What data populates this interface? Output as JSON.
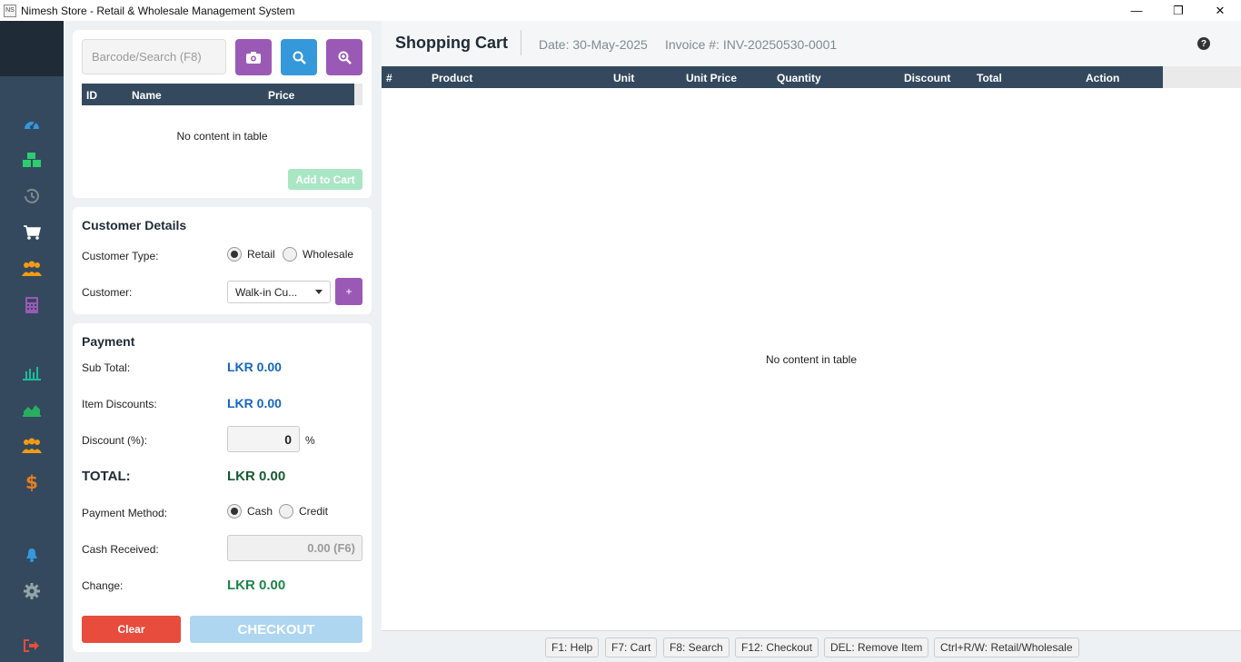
{
  "window": {
    "title": "Nimesh Store - Retail & Wholesale Management System",
    "minimize": "—",
    "restore": "❐",
    "close": "✕"
  },
  "sidebar": {
    "items": [
      {
        "name": "dashboard",
        "icon": "gauge-icon",
        "color": "#3498db"
      },
      {
        "name": "inventory",
        "icon": "cubes-icon",
        "color": "#2ecc71"
      },
      {
        "name": "history",
        "icon": "history-icon",
        "color": "#7f8c8d"
      },
      {
        "name": "pos",
        "icon": "cart-icon",
        "color": "#ffffff"
      },
      {
        "name": "customers",
        "icon": "users-icon",
        "color": "#f39c12"
      },
      {
        "name": "calculator",
        "icon": "calculator-icon",
        "color": "#9b59b6"
      },
      {
        "name": "reports",
        "icon": "bar-chart-icon",
        "color": "#1abc9c"
      },
      {
        "name": "analytics",
        "icon": "area-chart-icon",
        "color": "#27ae60"
      },
      {
        "name": "suppliers",
        "icon": "users-icon",
        "color": "#f39c12"
      },
      {
        "name": "finance",
        "icon": "dollar-icon",
        "color": "#e67e22"
      },
      {
        "name": "notifications",
        "icon": "bell-icon",
        "color": "#3498db"
      },
      {
        "name": "settings",
        "icon": "gear-icon",
        "color": "#95a5a6"
      },
      {
        "name": "logout",
        "icon": "sign-out-icon",
        "color": "#e74c3c"
      }
    ]
  },
  "search": {
    "placeholder": "Barcode/Search (F8)",
    "columns": [
      "ID",
      "Name",
      "Price"
    ],
    "empty_text": "No content in table",
    "add_to_cart": "Add to Cart"
  },
  "customer": {
    "title": "Customer Details",
    "type_label": "Customer Type:",
    "type_retail": "Retail",
    "type_wholesale": "Wholesale",
    "customer_label": "Customer:",
    "customer_value": "Walk-in Cu...",
    "add_label": "+"
  },
  "payment": {
    "title": "Payment",
    "subtotal_label": "Sub Total:",
    "subtotal_value": "LKR 0.00",
    "item_disc_label": "Item Discounts:",
    "item_disc_value": "LKR 0.00",
    "discount_label": "Discount (%):",
    "discount_value": "0",
    "percent": "%",
    "total_label": "TOTAL:",
    "total_value": "LKR 0.00",
    "method_label": "Payment Method:",
    "method_cash": "Cash",
    "method_credit": "Credit",
    "cash_label": "Cash Received:",
    "cash_placeholder": "0.00 (F6)",
    "change_label": "Change:",
    "change_value": "LKR 0.00",
    "clear": "Clear",
    "checkout": "CHECKOUT"
  },
  "cart": {
    "title": "Shopping Cart",
    "date": "Date: 30-May-2025",
    "invoice": "Invoice #: INV-20250530-0001",
    "help": "?",
    "columns": [
      "#",
      "Product",
      "Unit",
      "Unit Price",
      "Quantity",
      "Discount",
      "Total",
      "Action"
    ],
    "empty_text": "No content in table"
  },
  "shortcuts": [
    "F1: Help",
    "F7: Cart",
    "F8: Search",
    "F12: Checkout",
    "DEL: Remove Item",
    "Ctrl+R/W: Retail/Wholesale"
  ]
}
